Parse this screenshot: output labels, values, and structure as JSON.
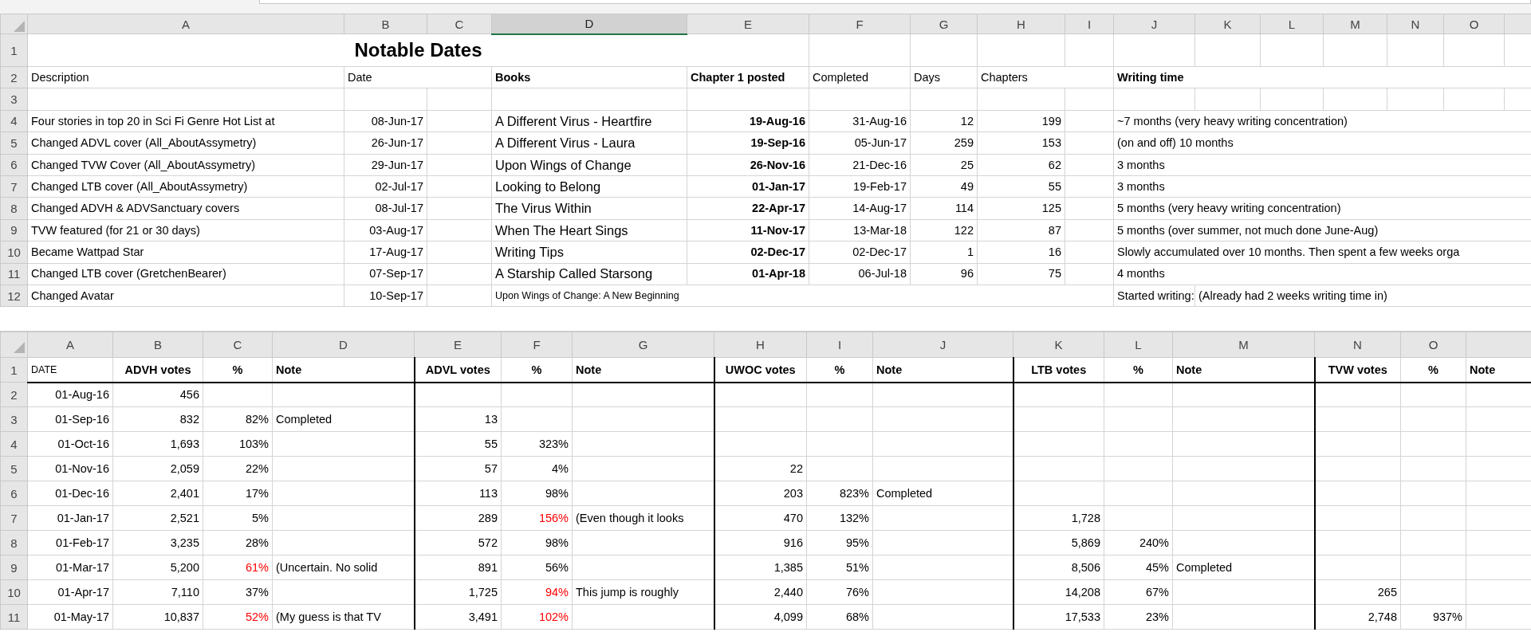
{
  "top_sheet": {
    "columns": [
      {
        "label": "A",
        "selected": false
      },
      {
        "label": "B",
        "selected": false
      },
      {
        "label": "C",
        "selected": false
      },
      {
        "label": "D",
        "selected": true
      },
      {
        "label": "E",
        "selected": false
      },
      {
        "label": "F",
        "selected": false
      },
      {
        "label": "G",
        "selected": false
      },
      {
        "label": "H",
        "selected": false
      },
      {
        "label": "I",
        "selected": false
      },
      {
        "label": "J",
        "selected": false
      },
      {
        "label": "K",
        "selected": false
      },
      {
        "label": "L",
        "selected": false
      },
      {
        "label": "M",
        "selected": false
      },
      {
        "label": "N",
        "selected": false
      },
      {
        "label": "O",
        "selected": false
      }
    ],
    "rows": [
      {
        "number": "1",
        "kind": "title",
        "cells": {
          "A": "Notable Dates"
        }
      },
      {
        "number": "2",
        "kind": "header",
        "cells": {
          "A": "Description",
          "B": "Date",
          "D": {
            "text": "Books",
            "bold": true
          },
          "E": {
            "text": "Chapter 1 posted",
            "bold": true
          },
          "F": "Completed",
          "G": "Days",
          "H": "Chapters",
          "J": {
            "text": "Writing time",
            "bold": true
          }
        }
      },
      {
        "number": "3",
        "kind": "data",
        "cells": {}
      },
      {
        "number": "4",
        "kind": "data",
        "cells": {
          "A": "Four stories in top 20 in Sci Fi Genre Hot List at",
          "B": "08-Jun-17",
          "D": "A Different Virus - Heartfire",
          "E": {
            "text": "19-Aug-16",
            "bold": true
          },
          "F": "31-Aug-16",
          "G": "12",
          "H": "199",
          "J": "~7 months (very heavy writing concentration)"
        }
      },
      {
        "number": "5",
        "kind": "data",
        "cells": {
          "A": "Changed ADVL cover (All_AboutAssymetry)",
          "B": "26-Jun-17",
          "D": "A Different Virus - Laura",
          "E": {
            "text": "19-Sep-16",
            "bold": true
          },
          "F": "05-Jun-17",
          "G": "259",
          "H": "153",
          "J": "(on and off) 10 months"
        }
      },
      {
        "number": "6",
        "kind": "data",
        "cells": {
          "A": "Changed TVW Cover (All_AboutAssymetry)",
          "B": "29-Jun-17",
          "D": "Upon Wings of Change",
          "E": {
            "text": "26-Nov-16",
            "bold": true
          },
          "F": "21-Dec-16",
          "G": "25",
          "H": "62",
          "J": "3 months"
        }
      },
      {
        "number": "7",
        "kind": "data",
        "cells": {
          "A": "Changed LTB cover (All_AboutAssymetry)",
          "B": "02-Jul-17",
          "D": "Looking to Belong",
          "E": {
            "text": "01-Jan-17",
            "bold": true
          },
          "F": "19-Feb-17",
          "G": "49",
          "H": "55",
          "J": "3 months"
        }
      },
      {
        "number": "8",
        "kind": "data",
        "cells": {
          "A": "Changed ADVH & ADVSanctuary covers",
          "B": "08-Jul-17",
          "D": "The Virus Within",
          "E": {
            "text": "22-Apr-17",
            "bold": true
          },
          "F": "14-Aug-17",
          "G": "114",
          "H": "125",
          "J": "5 months (very heavy writing concentration)"
        }
      },
      {
        "number": "9",
        "kind": "data",
        "cells": {
          "A": "TVW featured (for 21 or 30 days)",
          "B": "03-Aug-17",
          "D": "When The Heart Sings",
          "E": {
            "text": "11-Nov-17",
            "bold": true
          },
          "F": "13-Mar-18",
          "G": "122",
          "H": "87",
          "J": "5 months (over summer, not much done June-Aug)"
        }
      },
      {
        "number": "10",
        "kind": "data",
        "cells": {
          "A": "Became Wattpad Star",
          "B": "17-Aug-17",
          "D": "Writing Tips",
          "E": {
            "text": "02-Dec-17",
            "bold": true
          },
          "F": "02-Dec-17",
          "G": "1",
          "H": "16",
          "J": "Slowly accumulated over 10 months. Then spent a few weeks orga"
        }
      },
      {
        "number": "11",
        "kind": "data",
        "cells": {
          "A": "Changed LTB cover (GretchenBearer)",
          "B": "07-Sep-17",
          "D": "A Starship Called Starsong",
          "E": {
            "text": "01-Apr-18",
            "bold": true
          },
          "F": "06-Jul-18",
          "G": "96",
          "H": "75",
          "J": "4 months"
        }
      },
      {
        "number": "12",
        "kind": "data",
        "cells": {
          "A": "Changed Avatar",
          "B": "10-Sep-17",
          "D": {
            "text": "Upon Wings of Change: A New Beginning",
            "small": true
          },
          "J": "Started writing:",
          "K": "(Already had 2 weeks writing time in)"
        }
      }
    ]
  },
  "bottom_sheet": {
    "columns": [
      {
        "label": "A",
        "selected": false
      },
      {
        "label": "B",
        "selected": false
      },
      {
        "label": "C",
        "selected": false
      },
      {
        "label": "D",
        "selected": false
      },
      {
        "label": "E",
        "selected": false
      },
      {
        "label": "F",
        "selected": false
      },
      {
        "label": "G",
        "selected": false
      },
      {
        "label": "H",
        "selected": false
      },
      {
        "label": "I",
        "selected": false
      },
      {
        "label": "J",
        "selected": false
      },
      {
        "label": "K",
        "selected": false
      },
      {
        "label": "L",
        "selected": false
      },
      {
        "label": "M",
        "selected": false
      },
      {
        "label": "N",
        "selected": false
      },
      {
        "label": "O",
        "selected": false
      }
    ],
    "rows": [
      {
        "number": "1",
        "kind": "header",
        "cells": {
          "A": "DATE",
          "B": "ADVH votes",
          "C": "%",
          "D": "Note",
          "E": "ADVL votes",
          "F": "%",
          "G": "Note",
          "H": "UWOC votes",
          "I": "%",
          "J": "Note",
          "K": "LTB votes",
          "L": "%",
          "M": "Note",
          "N": "TVW votes",
          "O": "%",
          "P": "Note"
        }
      },
      {
        "number": "2",
        "kind": "data",
        "cells": {
          "A": "01-Aug-16",
          "B": "456"
        }
      },
      {
        "number": "3",
        "kind": "data",
        "cells": {
          "A": "01-Sep-16",
          "B": "832",
          "C": "82%",
          "D": "Completed",
          "E": "13"
        }
      },
      {
        "number": "4",
        "kind": "data",
        "cells": {
          "A": "01-Oct-16",
          "B": "1,693",
          "C": "103%",
          "E": "55",
          "F": "323%"
        }
      },
      {
        "number": "5",
        "kind": "data",
        "cells": {
          "A": "01-Nov-16",
          "B": "2,059",
          "C": "22%",
          "E": "57",
          "F": "4%",
          "H": "22"
        }
      },
      {
        "number": "6",
        "kind": "data",
        "cells": {
          "A": "01-Dec-16",
          "B": "2,401",
          "C": "17%",
          "E": "113",
          "F": "98%",
          "H": "203",
          "I": "823%",
          "J": "Completed"
        }
      },
      {
        "number": "7",
        "kind": "data",
        "cells": {
          "A": "01-Jan-17",
          "B": "2,521",
          "C": "5%",
          "E": "289",
          "F": {
            "text": "156%",
            "flagged": true
          },
          "G": "(Even though it looks",
          "H": "470",
          "I": "132%",
          "K": "1,728"
        }
      },
      {
        "number": "8",
        "kind": "data",
        "cells": {
          "A": "01-Feb-17",
          "B": "3,235",
          "C": "28%",
          "E": "572",
          "F": "98%",
          "H": "916",
          "I": "95%",
          "K": "5,869",
          "L": "240%"
        }
      },
      {
        "number": "9",
        "kind": "data",
        "cells": {
          "A": "01-Mar-17",
          "B": "5,200",
          "C": {
            "text": "61%",
            "flagged": true
          },
          "D": "(Uncertain. No solid",
          "E": "891",
          "F": "56%",
          "H": "1,385",
          "I": "51%",
          "K": "8,506",
          "L": "45%",
          "M": "Completed"
        }
      },
      {
        "number": "10",
        "kind": "data",
        "cells": {
          "A": "01-Apr-17",
          "B": "7,110",
          "C": "37%",
          "E": "1,725",
          "F": {
            "text": "94%",
            "flagged": true
          },
          "G": "This jump is roughly",
          "H": "2,440",
          "I": "76%",
          "K": "14,208",
          "L": "67%",
          "N": "265"
        }
      },
      {
        "number": "11",
        "kind": "data",
        "cells": {
          "A": "01-May-17",
          "B": "10,837",
          "C": {
            "text": "52%",
            "flagged": true
          },
          "D": "(My guess is that TV",
          "E": "3,491",
          "F": {
            "text": "102%",
            "flagged": true
          },
          "H": "4,099",
          "I": "68%",
          "K": "17,533",
          "L": "23%",
          "N": "2,748",
          "O": "937%"
        }
      }
    ]
  }
}
